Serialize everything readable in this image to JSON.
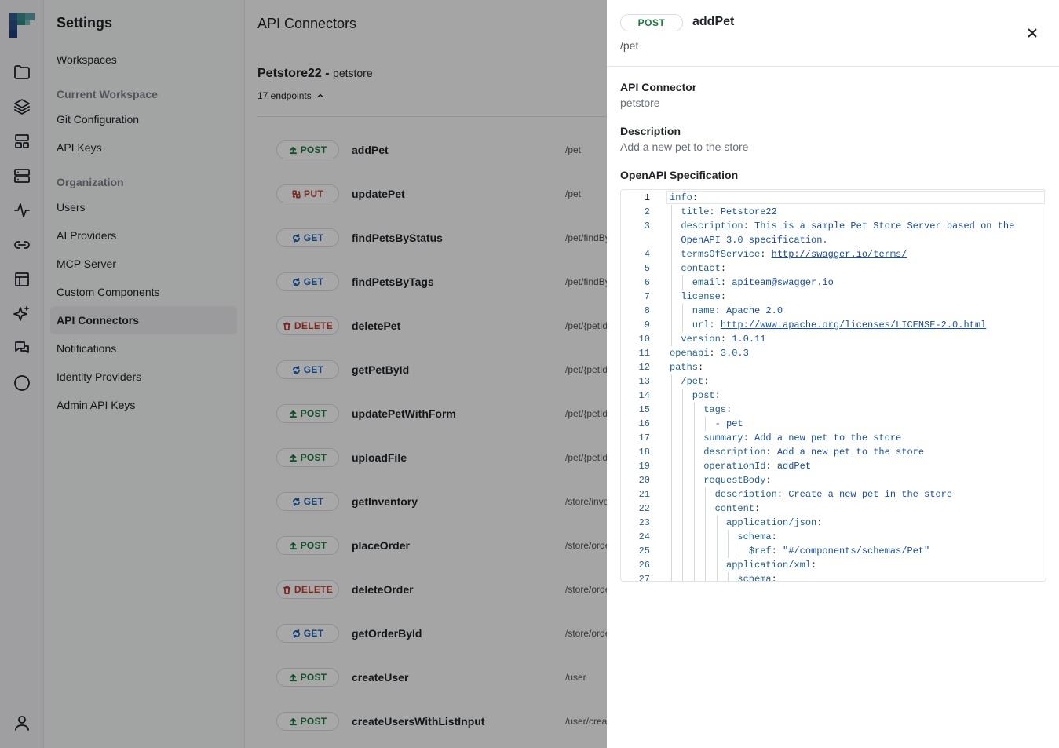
{
  "rail": {
    "icons": [
      "folder-icon",
      "layers-icon",
      "layout-icon",
      "server-icon",
      "activity-icon",
      "link-icon",
      "table-icon",
      "sparkles-icon",
      "chat-icon",
      "circle-icon",
      "user-icon"
    ]
  },
  "settings": {
    "title": "Settings",
    "items": {
      "workspaces": "Workspaces",
      "section_workspace": "Current Workspace",
      "git": "Git Configuration",
      "api_keys": "API Keys",
      "section_org": "Organization",
      "users": "Users",
      "ai_providers": "AI Providers",
      "mcp": "MCP Server",
      "custom": "Custom Components",
      "api_connectors": "API Connectors",
      "notifications": "Notifications",
      "identity": "Identity Providers",
      "admin_keys": "Admin API Keys"
    }
  },
  "main": {
    "title": "API Connectors",
    "connector_name": "Petstore22",
    "connector_sep": " - ",
    "connector_sub": "petstore",
    "endpoints_count": "17 endpoints",
    "endpoints": [
      {
        "method": "POST",
        "name": "addPet",
        "path": "/pet"
      },
      {
        "method": "PUT",
        "name": "updatePet",
        "path": "/pet"
      },
      {
        "method": "GET",
        "name": "findPetsByStatus",
        "path": "/pet/findByStatus"
      },
      {
        "method": "GET",
        "name": "findPetsByTags",
        "path": "/pet/findByTags"
      },
      {
        "method": "DELETE",
        "name": "deletePet",
        "path": "/pet/{petId}"
      },
      {
        "method": "GET",
        "name": "getPetById",
        "path": "/pet/{petId}"
      },
      {
        "method": "POST",
        "name": "updatePetWithForm",
        "path": "/pet/{petId}"
      },
      {
        "method": "POST",
        "name": "uploadFile",
        "path": "/pet/{petId}/uploadImage"
      },
      {
        "method": "GET",
        "name": "getInventory",
        "path": "/store/inventory"
      },
      {
        "method": "POST",
        "name": "placeOrder",
        "path": "/store/order"
      },
      {
        "method": "DELETE",
        "name": "deleteOrder",
        "path": "/store/order/{orderId}"
      },
      {
        "method": "GET",
        "name": "getOrderById",
        "path": "/store/order/{orderId}"
      },
      {
        "method": "POST",
        "name": "createUser",
        "path": "/user"
      },
      {
        "method": "POST",
        "name": "createUsersWithListInput",
        "path": "/user/createWithList"
      }
    ]
  },
  "drawer": {
    "method": "POST",
    "title": "addPet",
    "path": "/pet",
    "connector_label": "API Connector",
    "connector_value": "petstore",
    "description_label": "Description",
    "description_value": "Add a new pet to the store",
    "spec_label": "OpenAPI Specification"
  },
  "colors": {
    "POST": "#1d7a3f",
    "PUT": "#b5473a",
    "GET": "#2464b4",
    "DELETE": "#c0392b"
  },
  "code_lines": [
    {
      "n": "1",
      "i": 0,
      "k": "info",
      "v": ""
    },
    {
      "n": "2",
      "i": 1,
      "k": "title",
      "v": "Petstore22"
    },
    {
      "n": "3",
      "i": 1,
      "k": "description",
      "v": "This is a sample Pet Store Server based on the"
    },
    {
      "n": "",
      "i": 1,
      "k": "",
      "v": "OpenAPI 3.0 specification.",
      "cont": true
    },
    {
      "n": "4",
      "i": 1,
      "k": "termsOfService",
      "v": "http://swagger.io/terms/",
      "url": true
    },
    {
      "n": "5",
      "i": 1,
      "k": "contact",
      "v": ""
    },
    {
      "n": "6",
      "i": 2,
      "k": "email",
      "v": "apiteam@swagger.io"
    },
    {
      "n": "7",
      "i": 1,
      "k": "license",
      "v": ""
    },
    {
      "n": "8",
      "i": 2,
      "k": "name",
      "v": "Apache 2.0"
    },
    {
      "n": "9",
      "i": 2,
      "k": "url",
      "v": "http://www.apache.org/licenses/LICENSE-2.0.html",
      "url": true
    },
    {
      "n": "10",
      "i": 1,
      "k": "version",
      "v": "1.0.11"
    },
    {
      "n": "11",
      "i": 0,
      "k": "openapi",
      "v": "3.0.3"
    },
    {
      "n": "12",
      "i": 0,
      "k": "paths",
      "v": ""
    },
    {
      "n": "13",
      "i": 1,
      "k": "/pet",
      "v": ""
    },
    {
      "n": "14",
      "i": 2,
      "k": "post",
      "v": ""
    },
    {
      "n": "15",
      "i": 3,
      "k": "tags",
      "v": ""
    },
    {
      "n": "16",
      "i": 4,
      "k": "",
      "v": "- pet",
      "item": true
    },
    {
      "n": "17",
      "i": 3,
      "k": "summary",
      "v": "Add a new pet to the store"
    },
    {
      "n": "18",
      "i": 3,
      "k": "description",
      "v": "Add a new pet to the store"
    },
    {
      "n": "19",
      "i": 3,
      "k": "operationId",
      "v": "addPet"
    },
    {
      "n": "20",
      "i": 3,
      "k": "requestBody",
      "v": ""
    },
    {
      "n": "21",
      "i": 4,
      "k": "description",
      "v": "Create a new pet in the store"
    },
    {
      "n": "22",
      "i": 4,
      "k": "content",
      "v": ""
    },
    {
      "n": "23",
      "i": 5,
      "k": "application/json",
      "v": ""
    },
    {
      "n": "24",
      "i": 6,
      "k": "schema",
      "v": ""
    },
    {
      "n": "25",
      "i": 7,
      "k": "$ref",
      "v": "\"#/components/schemas/Pet\""
    },
    {
      "n": "26",
      "i": 5,
      "k": "application/xml",
      "v": ""
    },
    {
      "n": "27",
      "i": 6,
      "k": "schema",
      "v": ""
    }
  ]
}
